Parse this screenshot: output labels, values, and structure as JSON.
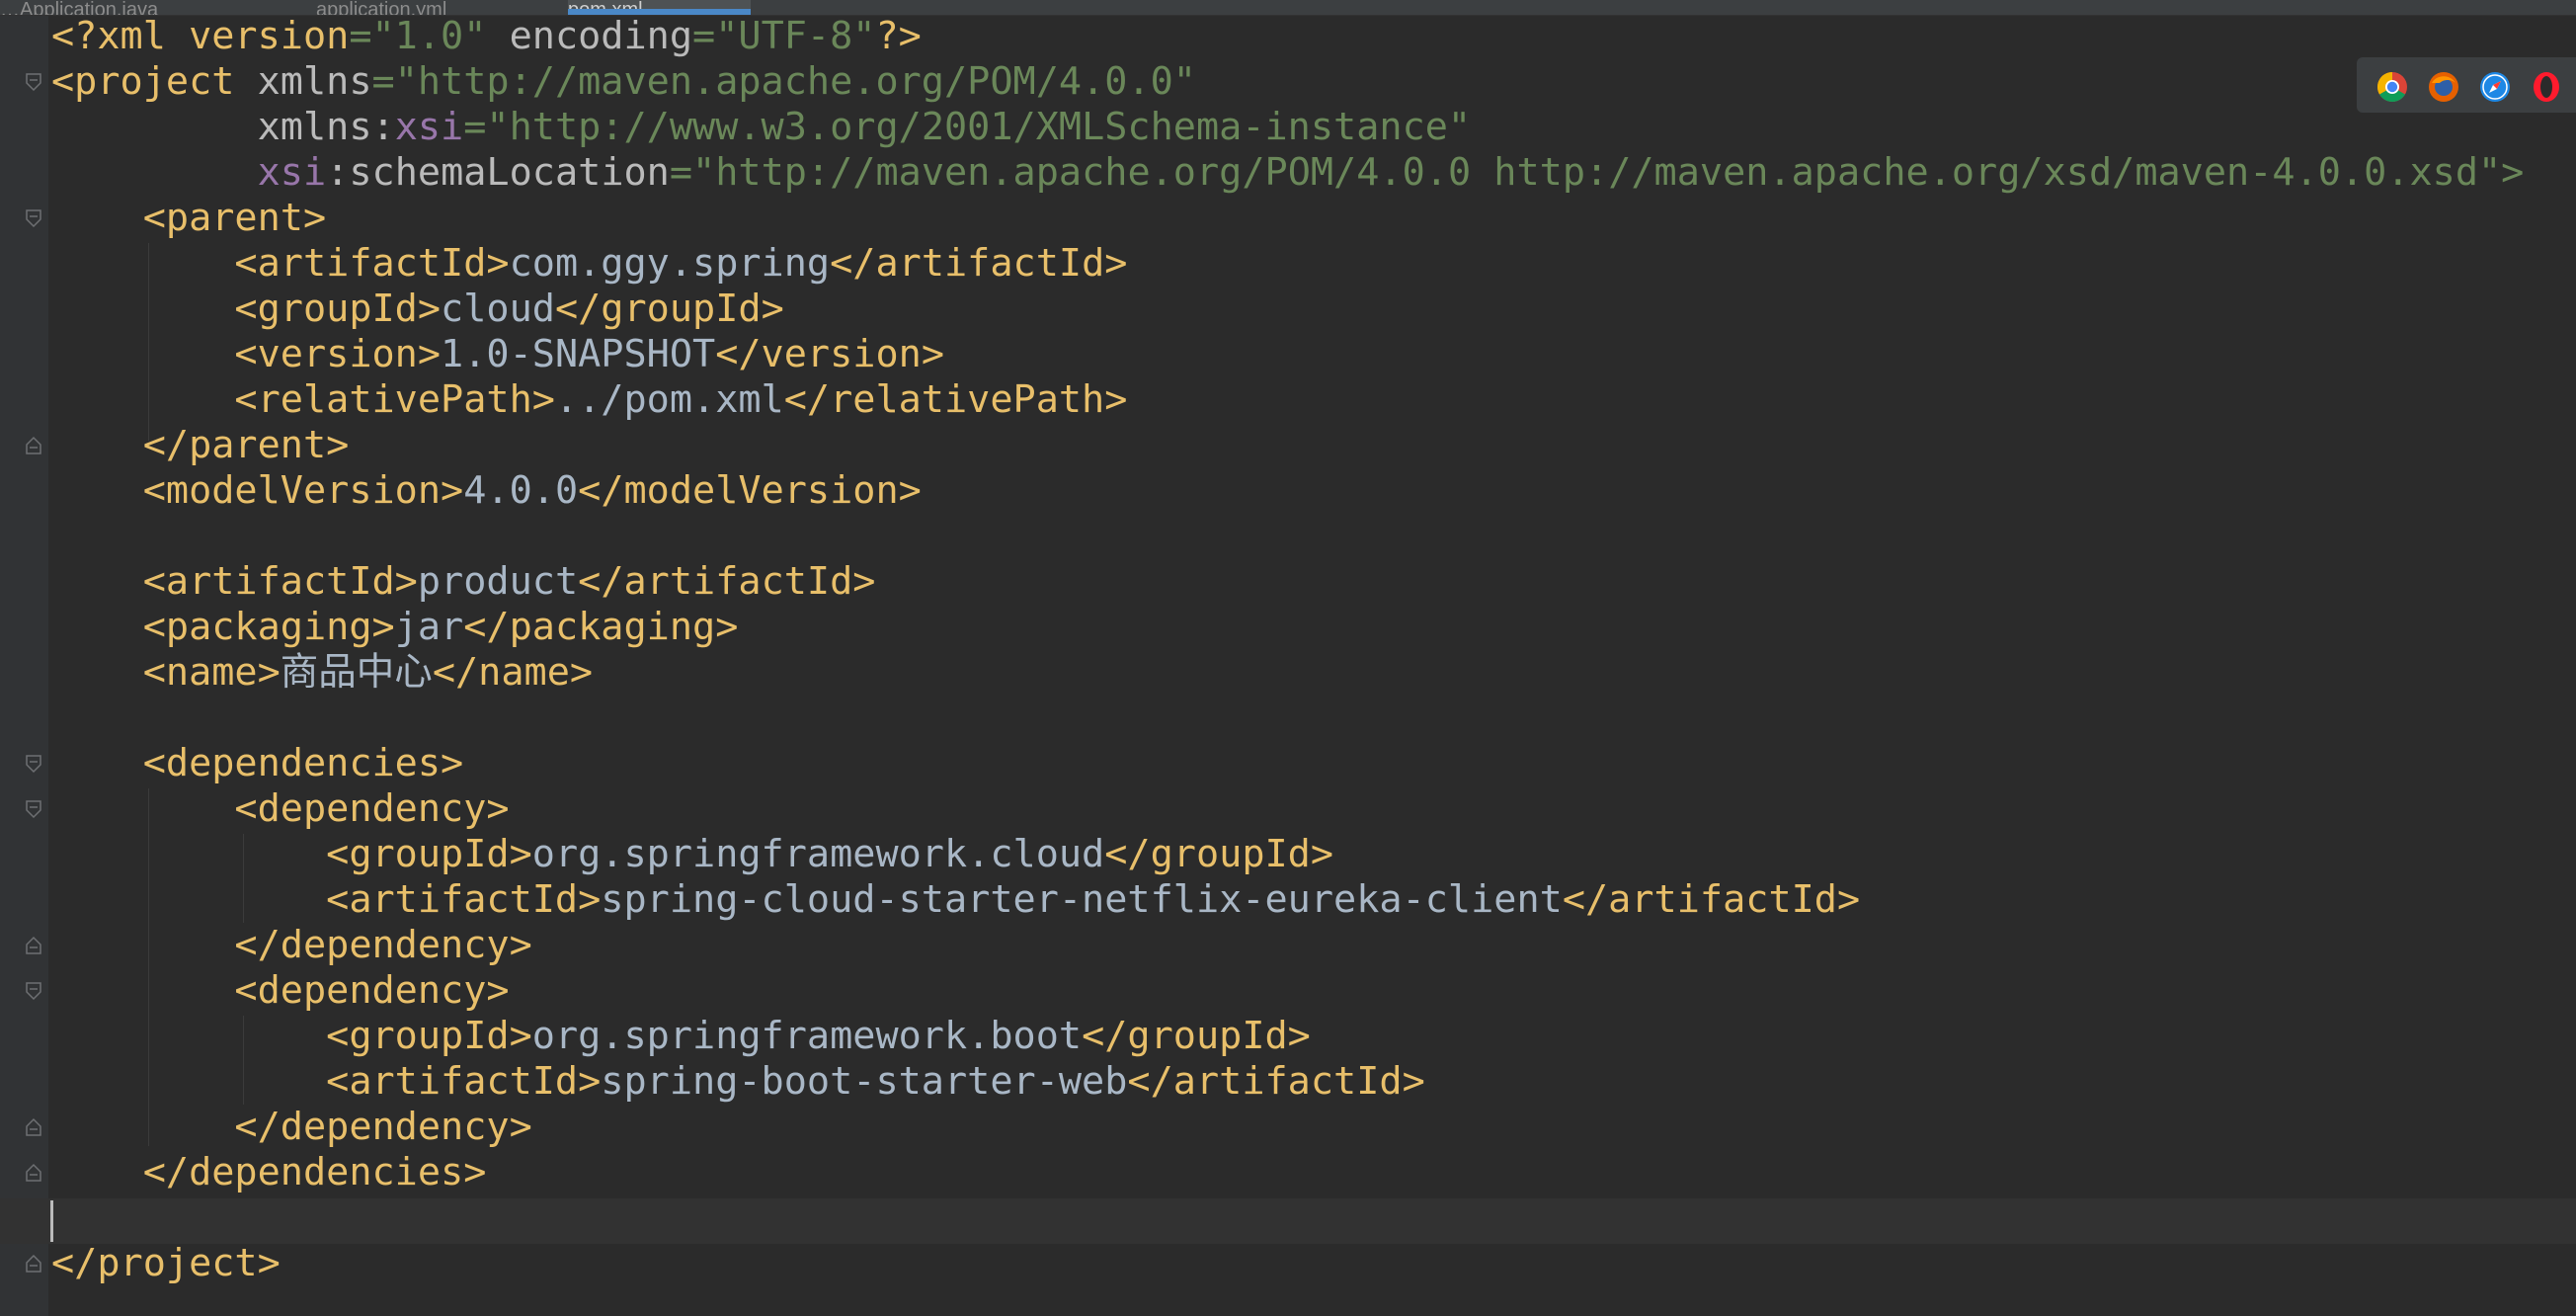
{
  "tabs": [
    {
      "label": "…Application.java",
      "active": false
    },
    {
      "label": "application.yml",
      "active": false
    },
    {
      "label": "pom.xml",
      "active": true
    }
  ],
  "browser_icons": [
    "chrome-icon",
    "firefox-icon",
    "safari-icon",
    "opera-icon"
  ],
  "code": {
    "l1": {
      "a": "<?xml version",
      "b": "=\"1.0\"",
      "c": " encoding",
      "d": "=\"UTF-8\"",
      "e": "?>"
    },
    "l2": {
      "a": "<project",
      "b": " xmlns",
      "c": "=\"http://maven.apache.org/POM/4.0.0\""
    },
    "l3": {
      "a": "         xmlns:",
      "b": "xsi",
      "c": "=\"http://www.w3.org/2001/XMLSchema-instance\""
    },
    "l4": {
      "a": "         ",
      "b": "xsi",
      "c": ":schemaLocation",
      "d": "=\"http://maven.apache.org/POM/4.0.0 http://maven.apache.org/xsd/maven-4.0.0.xsd\">"
    },
    "l5": {
      "a": "    <parent>"
    },
    "l6": {
      "a": "        <artifactId>",
      "b": "com.ggy.spring",
      "c": "</artifactId>"
    },
    "l7": {
      "a": "        <groupId>",
      "b": "cloud",
      "c": "</groupId>"
    },
    "l8": {
      "a": "        <version>",
      "b": "1.0-SNAPSHOT",
      "c": "</version>"
    },
    "l9": {
      "a": "        <relativePath>",
      "b": "../pom.xml",
      "c": "</relativePath>"
    },
    "l10": {
      "a": "    </parent>"
    },
    "l11": {
      "a": "    <modelVersion>",
      "b": "4.0.0",
      "c": "</modelVersion>"
    },
    "l13": {
      "a": "    <artifactId>",
      "b": "product",
      "c": "</artifactId>"
    },
    "l14": {
      "a": "    <packaging>",
      "b": "jar",
      "c": "</packaging>"
    },
    "l15": {
      "a": "    <name>",
      "b": "商品中心",
      "c": "</name>"
    },
    "l17": {
      "a": "    <dependencies>"
    },
    "l18": {
      "a": "        <dependency>"
    },
    "l19": {
      "a": "            <groupId>",
      "b": "org.springframework.cloud",
      "c": "</groupId>"
    },
    "l20": {
      "a": "            <artifactId>",
      "b": "spring-cloud-starter-netflix-eureka-client",
      "c": "</artifactId>"
    },
    "l21": {
      "a": "        </dependency>"
    },
    "l22": {
      "a": "        <dependency>"
    },
    "l23": {
      "a": "            <groupId>",
      "b": "org.springframework.boot",
      "c": "</groupId>"
    },
    "l24": {
      "a": "            <artifactId>",
      "b": "spring-boot-starter-web",
      "c": "</artifactId>"
    },
    "l25": {
      "a": "        </dependency>"
    },
    "l26": {
      "a": "    </dependencies>"
    },
    "l28": {
      "a": "</project>"
    }
  }
}
